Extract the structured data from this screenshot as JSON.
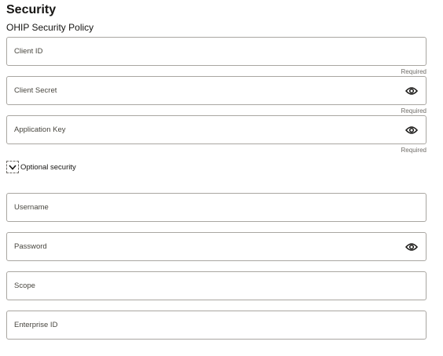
{
  "section": {
    "title": "Security",
    "subtitle": "OHIP Security Policy"
  },
  "required_fields": [
    {
      "label": "Client ID",
      "required_text": "Required",
      "has_eye": false
    },
    {
      "label": "Client Secret",
      "required_text": "Required",
      "has_eye": true,
      "eye_icon": "eye-icon"
    },
    {
      "label": "Application Key",
      "required_text": "Required",
      "has_eye": true,
      "eye_icon": "eye-icon"
    }
  ],
  "optional_toggle": {
    "label": "Optional security",
    "icon": "chevron-down-icon",
    "expanded": true
  },
  "optional_fields": [
    {
      "label": "Username",
      "has_eye": false
    },
    {
      "label": "Password",
      "has_eye": true,
      "eye_icon": "eye-icon"
    },
    {
      "label": "Scope",
      "has_eye": false
    },
    {
      "label": "Enterprise ID",
      "has_eye": false
    }
  ]
}
